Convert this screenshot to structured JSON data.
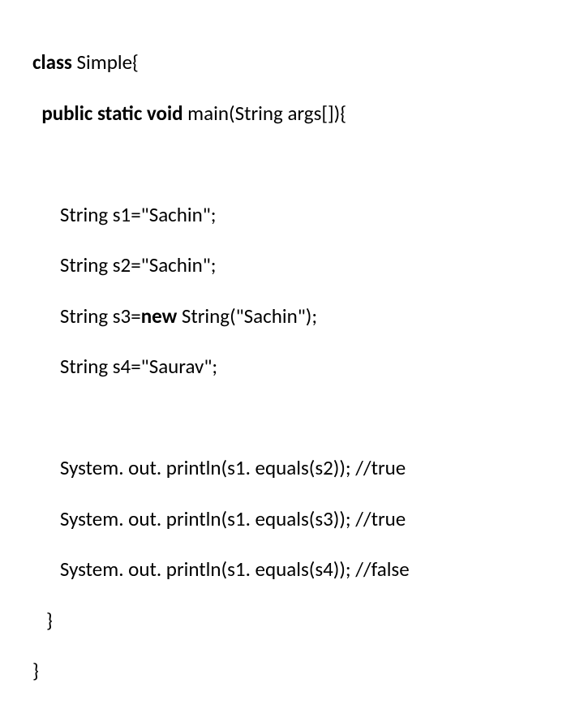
{
  "code": {
    "line1": {
      "kw_class": "class",
      "rest": " Simple{"
    },
    "line2": {
      "prefix": "  ",
      "kw_public_static_void": "public static void",
      "rest": " main(String args[]){"
    },
    "line3": "      String s1=\"Sachin\";",
    "line4": "      String s2=\"Sachin\";",
    "line5": {
      "prefix": "      String s3=",
      "kw_new": "new",
      "rest": " String(\"Sachin\");"
    },
    "line6": "      String s4=\"Saurav\";",
    "line7": "      System. out. println(s1. equals(s2)); //true",
    "line8": "      System. out. println(s1. equals(s3)); //true",
    "line9": "      System. out. println(s1. equals(s4)); //false",
    "line10": "   }",
    "line11": "}"
  }
}
